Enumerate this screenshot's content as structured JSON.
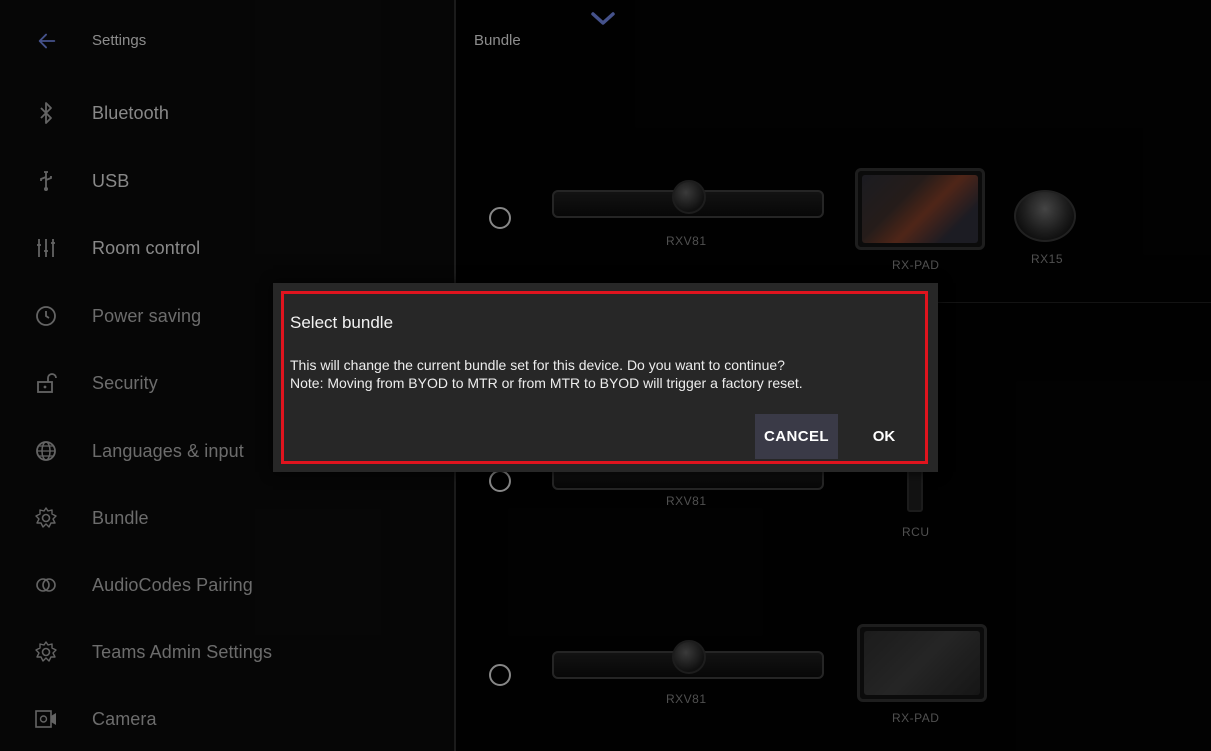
{
  "sidebar": {
    "title": "Settings",
    "items": [
      {
        "label": "Bluetooth",
        "icon": "bluetooth-icon"
      },
      {
        "label": "USB",
        "icon": "usb-icon"
      },
      {
        "label": "Room control",
        "icon": "sliders-icon"
      },
      {
        "label": "Power saving",
        "icon": "clock-icon"
      },
      {
        "label": "Security",
        "icon": "lock-icon"
      },
      {
        "label": "Languages & input",
        "icon": "globe-icon"
      },
      {
        "label": "Bundle",
        "icon": "gear-icon"
      },
      {
        "label": "AudioCodes Pairing",
        "icon": "rings-icon"
      },
      {
        "label": "Teams Admin Settings",
        "icon": "gear-icon"
      },
      {
        "label": "Camera",
        "icon": "camera-settings-icon"
      }
    ]
  },
  "pane": {
    "title": "Bundle",
    "bundles": [
      {
        "devices": [
          "RXV81",
          "RX-PAD",
          "RX15"
        ]
      },
      {
        "devices": [
          "RXV81",
          "RCU"
        ]
      },
      {
        "devices": [
          "RXV81",
          "RX-PAD"
        ]
      }
    ]
  },
  "dialog": {
    "title": "Select bundle",
    "message_line1": "This will change the current bundle set for this device. Do you want to continue?",
    "message_line2": "Note: Moving from BYOD to MTR or from MTR to BYOD will trigger a factory reset.",
    "cancel_label": "CANCEL",
    "ok_label": "OK"
  },
  "colors": {
    "accent": "#6b7fd6",
    "highlight": "#e0141e",
    "dialog_bg": "#272727",
    "cancel_bg": "#3a3a47"
  }
}
